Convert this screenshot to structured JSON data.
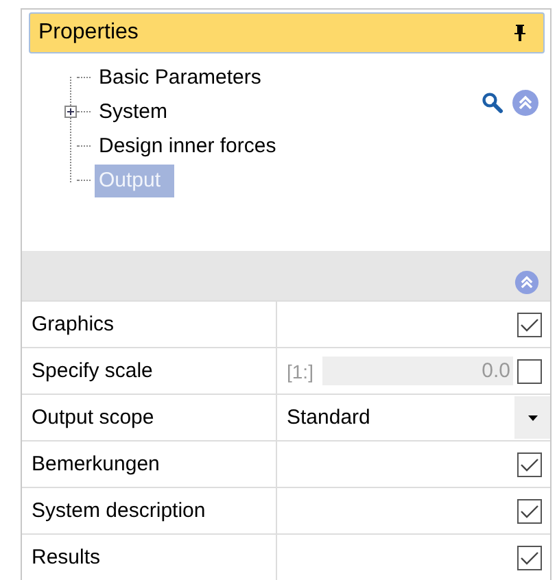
{
  "panel": {
    "title": "Properties"
  },
  "tree": [
    {
      "label": "Basic Parameters",
      "selected": false
    },
    {
      "label": "System",
      "selected": false,
      "expanded": false
    },
    {
      "label": "Design inner forces",
      "selected": false
    },
    {
      "label": "Output",
      "selected": true
    }
  ],
  "rows": [
    {
      "kind": "checkbox",
      "label": "Graphics",
      "checked": true
    },
    {
      "kind": "scale",
      "label": "Specify scale",
      "prefix": "[1:]",
      "value": "0.0",
      "checked": false
    },
    {
      "kind": "dropdown",
      "label": "Output scope",
      "value": "Standard"
    },
    {
      "kind": "checkbox",
      "label": "Bemerkungen",
      "checked": true
    },
    {
      "kind": "checkbox",
      "label": "System description",
      "checked": true
    },
    {
      "kind": "checkbox",
      "label": "Results",
      "checked": true
    }
  ]
}
